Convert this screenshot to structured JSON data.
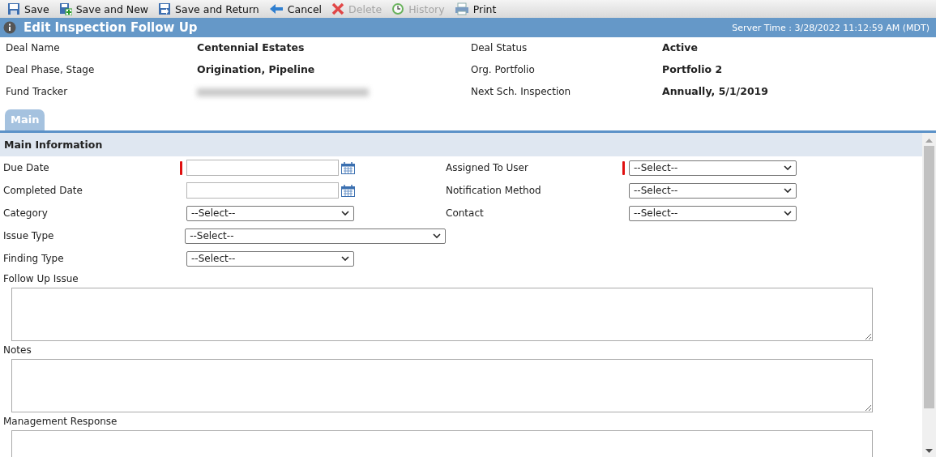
{
  "toolbar": [
    {
      "label": "Save",
      "kind": "save",
      "disabled": false
    },
    {
      "label": "Save and New",
      "kind": "new",
      "disabled": false
    },
    {
      "label": "Save and Return",
      "kind": "return",
      "disabled": false
    },
    {
      "label": "Cancel",
      "kind": "cancel",
      "disabled": false
    },
    {
      "label": "Delete",
      "kind": "delete",
      "disabled": true
    },
    {
      "label": "History",
      "kind": "history",
      "disabled": true
    },
    {
      "label": "Print",
      "kind": "print",
      "disabled": false
    }
  ],
  "header": {
    "title": "Edit Inspection Follow Up",
    "server_time": "Server Time : 3/28/2022 11:12:59 AM (MDT)"
  },
  "info": [
    {
      "label": "Deal Name",
      "value": "Centennial Estates"
    },
    {
      "label": "Deal Status",
      "value": "Active"
    },
    {
      "label": "Deal Phase, Stage",
      "value": "Origination, Pipeline"
    },
    {
      "label": "Org. Portfolio",
      "value": "Portfolio 2"
    },
    {
      "label": "Fund Tracker",
      "blurred": true
    },
    {
      "label": "Next Sch. Inspection",
      "value": "Annually, 5/1/2019"
    }
  ],
  "tabs": [
    {
      "label": "Main",
      "selected": true
    }
  ],
  "section": {
    "title": "Main Information"
  },
  "rows": [
    {
      "fields": [
        {
          "label": "Due Date",
          "kind": "date",
          "required": true
        },
        {
          "label": "Assigned To User",
          "kind": "select",
          "value": "--Select--",
          "required": true
        }
      ]
    },
    {
      "fields": [
        {
          "label": "Completed Date",
          "kind": "date",
          "required": false
        },
        {
          "label": "Notification Method",
          "kind": "select",
          "value": "--Select--",
          "required": false
        }
      ]
    },
    {
      "fields": [
        {
          "label": "Category",
          "kind": "select",
          "value": "--Select--",
          "required": false
        },
        {
          "label": "Contact",
          "kind": "select",
          "value": "--Select--",
          "required": false
        }
      ]
    },
    {
      "fields": [
        {
          "label": "Issue Type",
          "kind": "wide-select",
          "value": "--Select--",
          "required": false
        }
      ]
    },
    {
      "fields": [
        {
          "label": "Finding Type",
          "kind": "select",
          "value": "--Select--",
          "required": false
        }
      ]
    }
  ],
  "text_areas": [
    {
      "label": "Follow Up Issue"
    },
    {
      "label": "Notes"
    },
    {
      "label": "Management Response"
    }
  ]
}
